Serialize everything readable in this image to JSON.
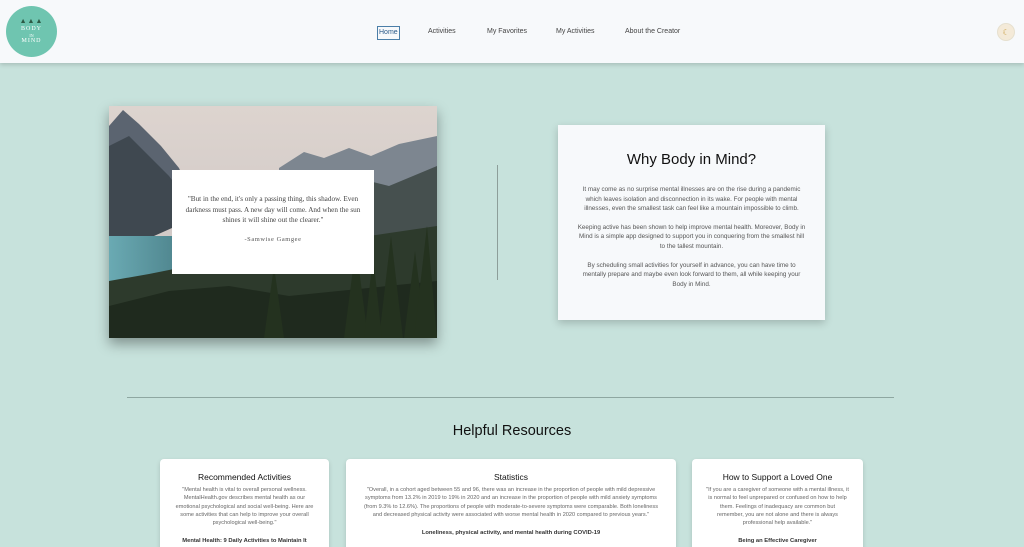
{
  "logo": {
    "top": "BODY",
    "mid": "IN",
    "bottom": "MIND",
    "trees": "▲▲▲"
  },
  "nav": {
    "items": [
      {
        "label": "Home",
        "active": true
      },
      {
        "label": "Activities",
        "active": false
      },
      {
        "label": "My Favorites",
        "active": false
      },
      {
        "label": "My Activities",
        "active": false
      },
      {
        "label": "About the Creator",
        "active": false
      }
    ],
    "theme_toggle_icon": "☾"
  },
  "hero": {
    "quote": "\"But in the end, it's only a passing thing, this shadow. Even darkness must pass. A new day will come. And when the sun shines it will shine out the clearer.\"",
    "author": "-Samwise Gamgee"
  },
  "why": {
    "title": "Why Body in Mind?",
    "paragraphs": [
      "It may come as no surprise mental illnesses are on the rise during a pandemic which leaves isolation and disconnection in its wake. For people with mental illnesses, even the smallest task can feel like a mountain impossible to climb.",
      "Keeping active has been shown to help improve mental health. Moreover, Body in Mind is a simple app designed to support you in conquering from the smallest hill to the tallest mountain.",
      "By scheduling small activities for yourself in advance, you can have time to mentally prepare and maybe even look forward to them, all while keeping your Body in Mind."
    ]
  },
  "resources": {
    "title": "Helpful Resources",
    "cards": [
      {
        "title": "Recommended Activities",
        "text": "\"Mental health is vital to overall personal wellness. MentalHealth.gov describes mental health as our emotional psychological and social well-being. Here are some activities that can help to improve your overall psychological well-being.\"",
        "link": "Mental Health: 9 Daily Activities to Maintain It"
      },
      {
        "title": "Statistics",
        "text": "\"Overall, in a cohort aged between 55 and 96, there was an increase in the proportion of people with mild depressive symptoms from 13.2% in 2019 to 19% in 2020 and an increase in the proportion of people with mild anxiety symptoms (from 9.3% to 12.6%). The proportions of people with moderate-to-severe symptoms were comparable. Both loneliness and decreased physical activity were associated with worse mental health in 2020 compared to previous years.\"",
        "link": "Loneliness, physical activity, and mental health during COVID-19"
      },
      {
        "title": "How to Support a Loved One",
        "text": "\"If you are a caregiver of someone with a mental illness, it is normal to feel unprepared or confused on how to help them. Feelings of inadequacy are common but remember, you are not alone and there is always professional help available.\"",
        "link": "Being an Effective Caregiver"
      }
    ]
  }
}
